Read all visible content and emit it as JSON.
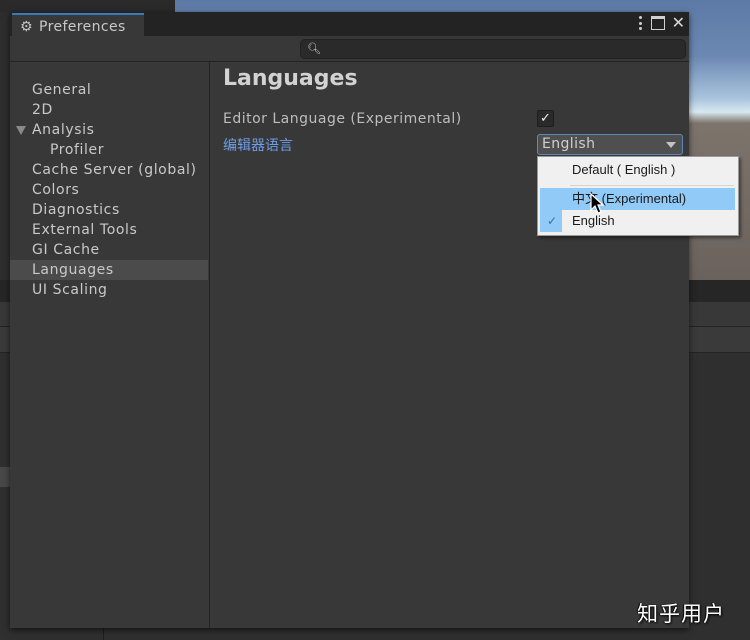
{
  "window": {
    "title": "Preferences",
    "tab_icon": "gear-icon",
    "controls": [
      "more-options-icon",
      "maximize-icon",
      "close-icon"
    ]
  },
  "search": {
    "placeholder": "",
    "value": ""
  },
  "sidebar": {
    "items": [
      {
        "label": "General",
        "selected": false
      },
      {
        "label": "2D",
        "selected": false
      },
      {
        "label": "Analysis",
        "selected": false,
        "expanded": true
      },
      {
        "label": "Profiler",
        "selected": false,
        "child": true
      },
      {
        "label": "Cache Server (global)",
        "selected": false
      },
      {
        "label": "Colors",
        "selected": false
      },
      {
        "label": "Diagnostics",
        "selected": false
      },
      {
        "label": "External Tools",
        "selected": false
      },
      {
        "label": "GI Cache",
        "selected": false
      },
      {
        "label": "Languages",
        "selected": true
      },
      {
        "label": "UI Scaling",
        "selected": false
      }
    ]
  },
  "content": {
    "heading": "Languages",
    "editor_language_label": "Editor Language (Experimental)",
    "editor_language_enabled": true,
    "checkbox_glyph": "✓",
    "localized_label": "编辑器语言",
    "dropdown_value": "English"
  },
  "menu": {
    "items": [
      {
        "label": "Default ( English )",
        "checked": false,
        "hovered": false
      },
      {
        "label": "中文 (Experimental)",
        "checked": false,
        "hovered": true
      },
      {
        "label": "English",
        "checked": true,
        "hovered": false
      }
    ],
    "check_glyph": "✓"
  },
  "watermark": "知乎用户",
  "colors": {
    "accent_tab": "#3a79bb",
    "link_label": "#6d9ee6",
    "menu_hover": "#91c9f7",
    "window_bg": "#383838"
  }
}
